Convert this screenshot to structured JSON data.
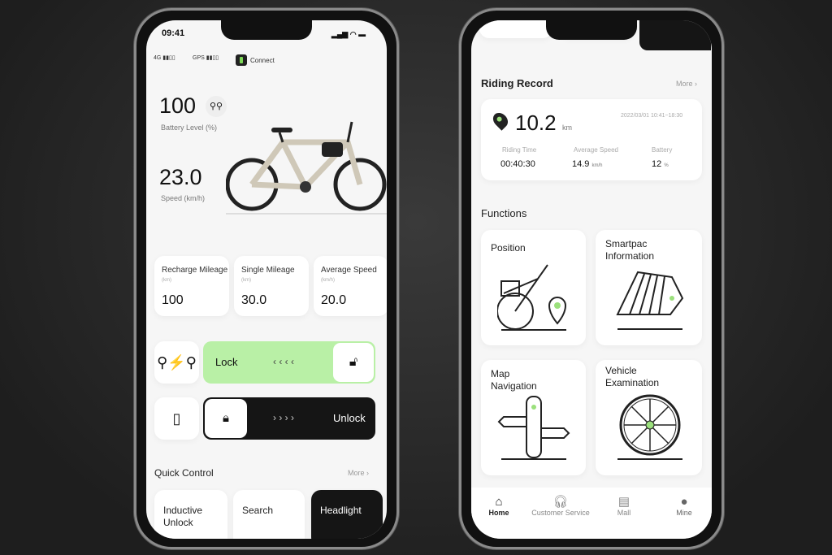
{
  "left": {
    "status": {
      "time": "09:41",
      "net1": "4G",
      "net2": "GPS",
      "connect": "Connect"
    },
    "battery": {
      "value": "100",
      "label": "Battery Level (%)"
    },
    "speed": {
      "value": "23.0",
      "label": "Speed (km/h)"
    },
    "stats": [
      {
        "label": "Recharge Mileage",
        "unit": "(km)",
        "value": "100"
      },
      {
        "label": "Single Mileage",
        "unit": "(km)",
        "value": "30.0"
      },
      {
        "label": "Average Speed",
        "unit": "(km/h)",
        "value": "20.0"
      }
    ],
    "lock": {
      "label": "Lock",
      "arrows": "‹ ‹ ‹ ‹",
      "color": "#b9f0a6"
    },
    "unlock": {
      "label": "Unlock",
      "arrows": "› › › ›"
    },
    "quick": {
      "title": "Quick Control",
      "more": "More ›",
      "items": [
        "Inductive Unlock",
        "Search",
        "Headlight"
      ]
    }
  },
  "right": {
    "record": {
      "title": "Riding Record",
      "more": "More ›",
      "distance": "10.2",
      "unit": "km",
      "time_range": "2022/03/01 10:41~18:30",
      "metrics": [
        {
          "label": "Riding Time",
          "value": "00:40:30",
          "unit": ""
        },
        {
          "label": "Average Speed",
          "value": "14.9",
          "unit": "km/h"
        },
        {
          "label": "Battery",
          "value": "12",
          "unit": "%"
        }
      ]
    },
    "functions": {
      "title": "Functions",
      "items": [
        "Position",
        "Smartpac Information",
        "Map Navigation",
        "Vehicle Examination"
      ]
    },
    "tabs": [
      "Home",
      "Customer Service",
      "Mall",
      "Mine"
    ],
    "accent": "#9be07c"
  }
}
